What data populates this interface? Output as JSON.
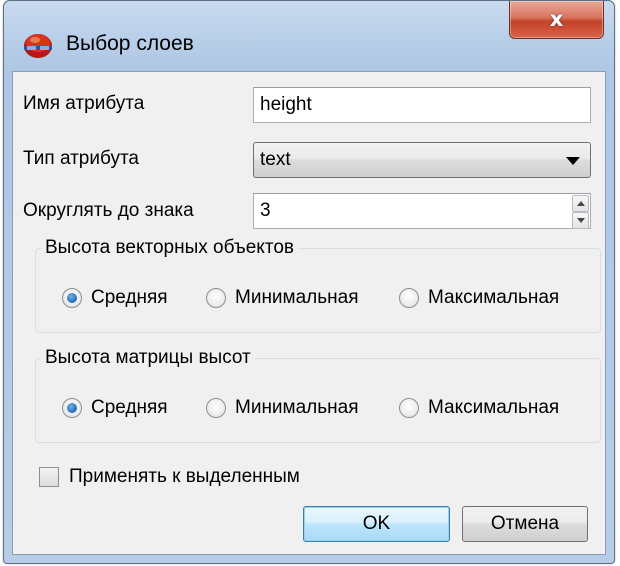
{
  "window": {
    "title": "Выбор слоев",
    "close_glyph": "x"
  },
  "fields": {
    "attr_name_label": "Имя атрибута",
    "attr_name_value": "height",
    "attr_type_label": "Тип атрибута",
    "attr_type_value": "text",
    "round_label": "Округлять до знака",
    "round_value": "3"
  },
  "group_vector": {
    "title": "Высота векторных объектов",
    "options": [
      "Средняя",
      "Минимальная",
      "Максимальная"
    ],
    "selected": "Средняя"
  },
  "group_dem": {
    "title": "Высота матрицы высот",
    "options": [
      "Средняя",
      "Минимальная",
      "Максимальная"
    ],
    "selected": "Средняя"
  },
  "apply_selected": {
    "label": "Применять к выделенным",
    "checked": false
  },
  "buttons": {
    "ok": "OK",
    "cancel": "Отмена"
  },
  "icons": {
    "app": "layers-globe-icon",
    "close": "close-icon",
    "dropdown": "chevron-down-icon"
  },
  "colors": {
    "title_bar": "#bcd1ea",
    "close_button": "#c9503a",
    "dialog_bg": "#f0f0f0",
    "radio_selected": "#2b73b8"
  }
}
